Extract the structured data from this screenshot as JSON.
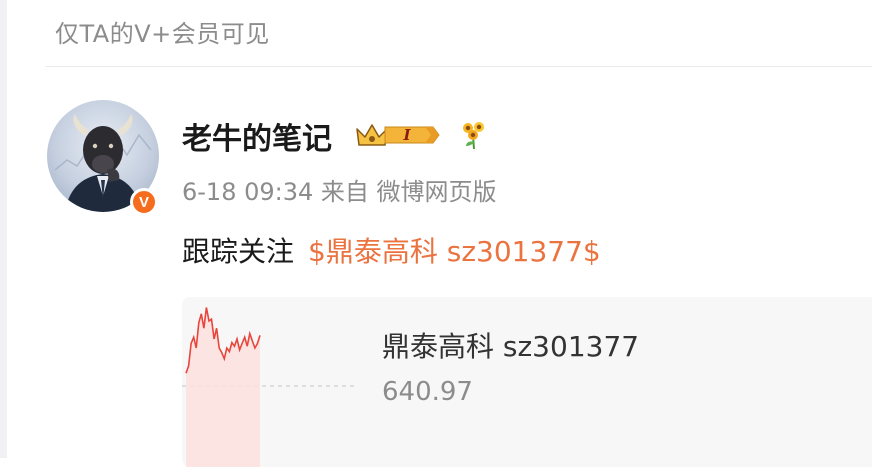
{
  "visibility_note": "仅TA的V+会员可见",
  "post": {
    "author": {
      "name": "老牛的笔记",
      "avatar_icon": "bull-businessman-avatar",
      "verified_icon": "verified-v-icon",
      "verified_glyph": "V",
      "vip_level": "I",
      "vip_icon": "vip-crown-badge-icon",
      "fan_icon": "sunflower-icon"
    },
    "meta": "6-18 09:34 来自 微博网页版",
    "text_prefix": "跟踪关注",
    "stock_link": "$鼎泰高科 sz301377$",
    "card": {
      "title": "鼎泰高科 sz301377",
      "price": "640.97",
      "spark_color": "#e8453c",
      "spark_fill": "#fbe0de",
      "spark_points": [
        0.22,
        0.3,
        0.55,
        0.62,
        0.5,
        0.78,
        0.88,
        0.72,
        0.95,
        0.8,
        0.82,
        0.6,
        0.72,
        0.5,
        0.45,
        0.38,
        0.5,
        0.46,
        0.56,
        0.52,
        0.6,
        0.48,
        0.55,
        0.62,
        0.52,
        0.66,
        0.58,
        0.5,
        0.55,
        0.64
      ]
    }
  },
  "colors": {
    "link": "#eb7340",
    "verified": "#f56c1c",
    "muted_text": "#8c8c8c"
  }
}
